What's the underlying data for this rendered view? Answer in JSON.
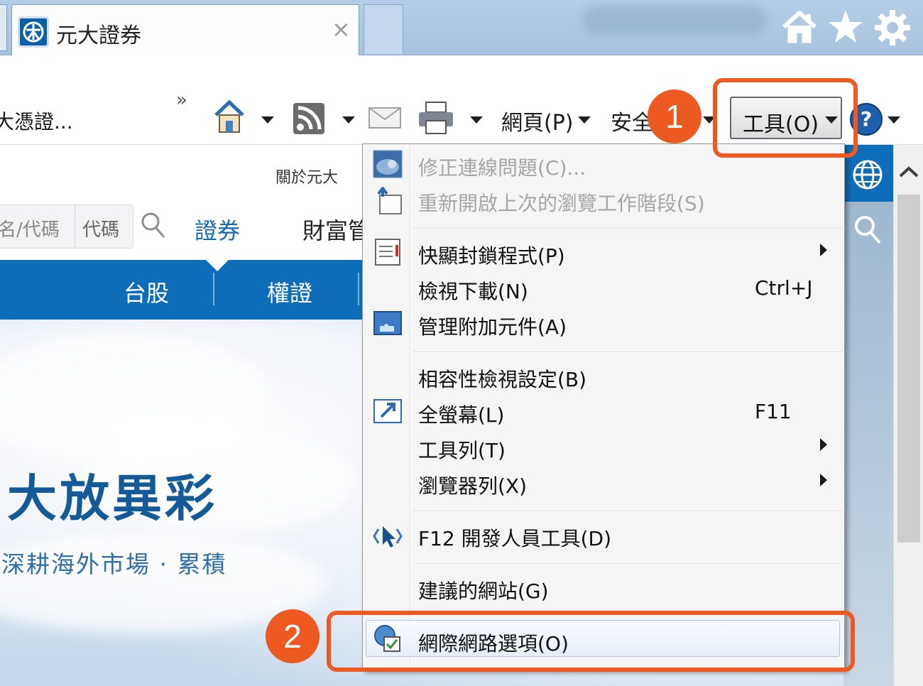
{
  "tab": {
    "title": "元大證券",
    "close": "×"
  },
  "cmdbar": {
    "overflow": "»",
    "truncated_favorite": "大憑證...",
    "page_label": "網頁(P)",
    "safety_label": "安全",
    "tools_label": "工具(O)"
  },
  "page": {
    "about": "關於元大",
    "search_placeholder": "名/代碼",
    "search_code_label": "代碼",
    "nav_securities": "證券",
    "nav_wealth": "財富管",
    "band_items": [
      "台股",
      "權證"
    ],
    "hero_title": "大放異彩",
    "hero_subtitle": "深耕海外市場 · 累積"
  },
  "menu": {
    "items": [
      {
        "label": "修正連線問題(C)...",
        "shortcut": "",
        "disabled": true
      },
      {
        "label": "重新開啟上次的瀏覽工作階段(S)",
        "shortcut": "",
        "disabled": true
      },
      {
        "label": "快顯封鎖程式(P)",
        "shortcut": "",
        "disabled": false
      },
      {
        "label": "檢視下載(N)",
        "shortcut": "Ctrl+J",
        "disabled": false
      },
      {
        "label": "管理附加元件(A)",
        "shortcut": "",
        "disabled": false
      },
      {
        "label": "相容性檢視設定(B)",
        "shortcut": "",
        "disabled": false
      },
      {
        "label": "全螢幕(L)",
        "shortcut": "F11",
        "disabled": false
      },
      {
        "label": "工具列(T)",
        "shortcut": "",
        "disabled": false
      },
      {
        "label": "瀏覽器列(X)",
        "shortcut": "",
        "disabled": false
      },
      {
        "label": "F12 開發人員工具(D)",
        "shortcut": "",
        "disabled": false
      },
      {
        "label": "建議的網站(G)",
        "shortcut": "",
        "disabled": false
      },
      {
        "label": "網際網路選項(O)",
        "shortcut": "",
        "disabled": false
      }
    ]
  },
  "callouts": {
    "step1": "1",
    "step2": "2"
  },
  "colors": {
    "accent": "#ec5a22",
    "brand_blue": "#0e6db9"
  }
}
